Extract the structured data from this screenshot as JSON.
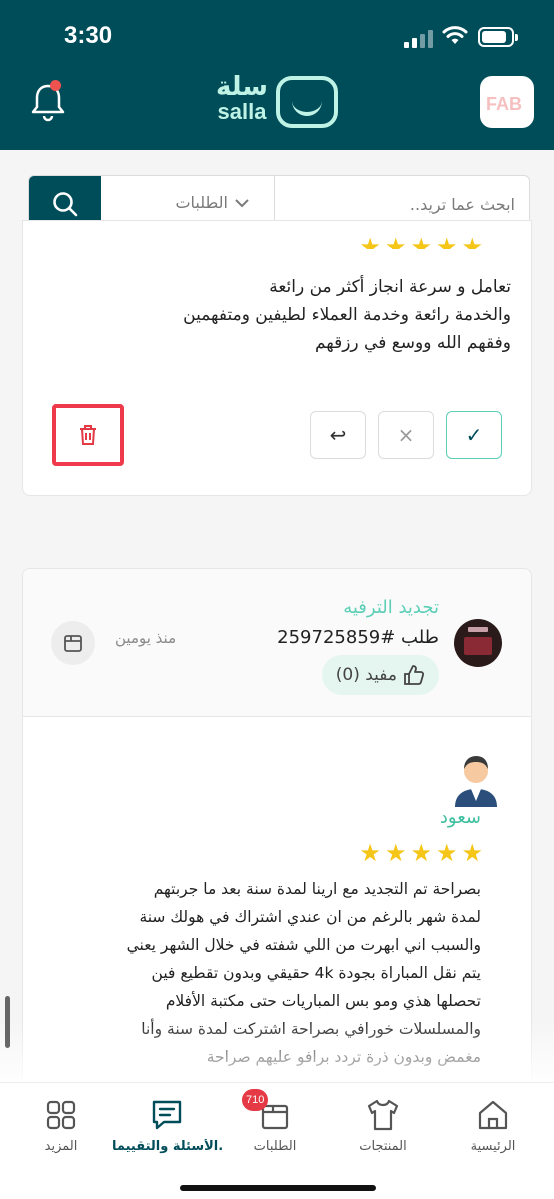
{
  "status_bar": {
    "time": "3:30"
  },
  "header": {
    "logo_ar": "سلة",
    "logo_en": "salla",
    "store_avatar_text": "FAB"
  },
  "search": {
    "placeholder": "ابحث عما تريد..",
    "scope": "الطلبات"
  },
  "review1": {
    "rating": 5,
    "text_lines": [
      "تعامل و سرعة انجاز أكثر من رائعة",
      "والخدمة رائعة وخدمة العملاء لطيفين ومتفهمين",
      "وفقهم الله ووسع في رزقهم"
    ],
    "actions": {
      "approve": "✓",
      "reject": "×",
      "reply": "↩"
    }
  },
  "review2": {
    "product_title": "تجديد الترفيه",
    "order_label": "طلب #259725859",
    "helpful": "مفيد (0)",
    "time_ago": "منذ يومين",
    "reviewer": "سعود",
    "rating": 5,
    "text_lines": [
      "بصراحة تم التجديد مع ارينا لمدة سنة بعد ما جربتهم",
      "لمدة شهر بالرغم من ان عندي اشتراك في هولك سنة",
      "والسبب اني ابهرت من اللي شفته في خلال الشهر يعني",
      "يتم نقل المباراة بجودة 4k حقيقي وبدون تقطيع فين",
      "تحصلها هذي ومو بس المباريات حتى مكتبة الأفلام",
      "والمسلسلات خورافي بصراحة اشتركت لمدة سنة وأنا",
      "مغمض وبدون ذرة تردد برافو عليهم صراحة"
    ]
  },
  "bottom_nav": {
    "items": [
      {
        "label": "الرئيسية",
        "icon": "home-icon"
      },
      {
        "label": "المنتجات",
        "icon": "shirt-icon"
      },
      {
        "label": "الطلبات",
        "icon": "orders-icon",
        "badge": "710"
      },
      {
        "label": "الأسئلة والتقييما...",
        "icon": "chat-icon",
        "active": true
      },
      {
        "label": "المزيد",
        "icon": "grid-icon"
      }
    ]
  },
  "colors": {
    "brand": "#004d5a",
    "accent": "#5ccfb6",
    "star": "#f5c518",
    "highlight": "#ee3a4a"
  }
}
